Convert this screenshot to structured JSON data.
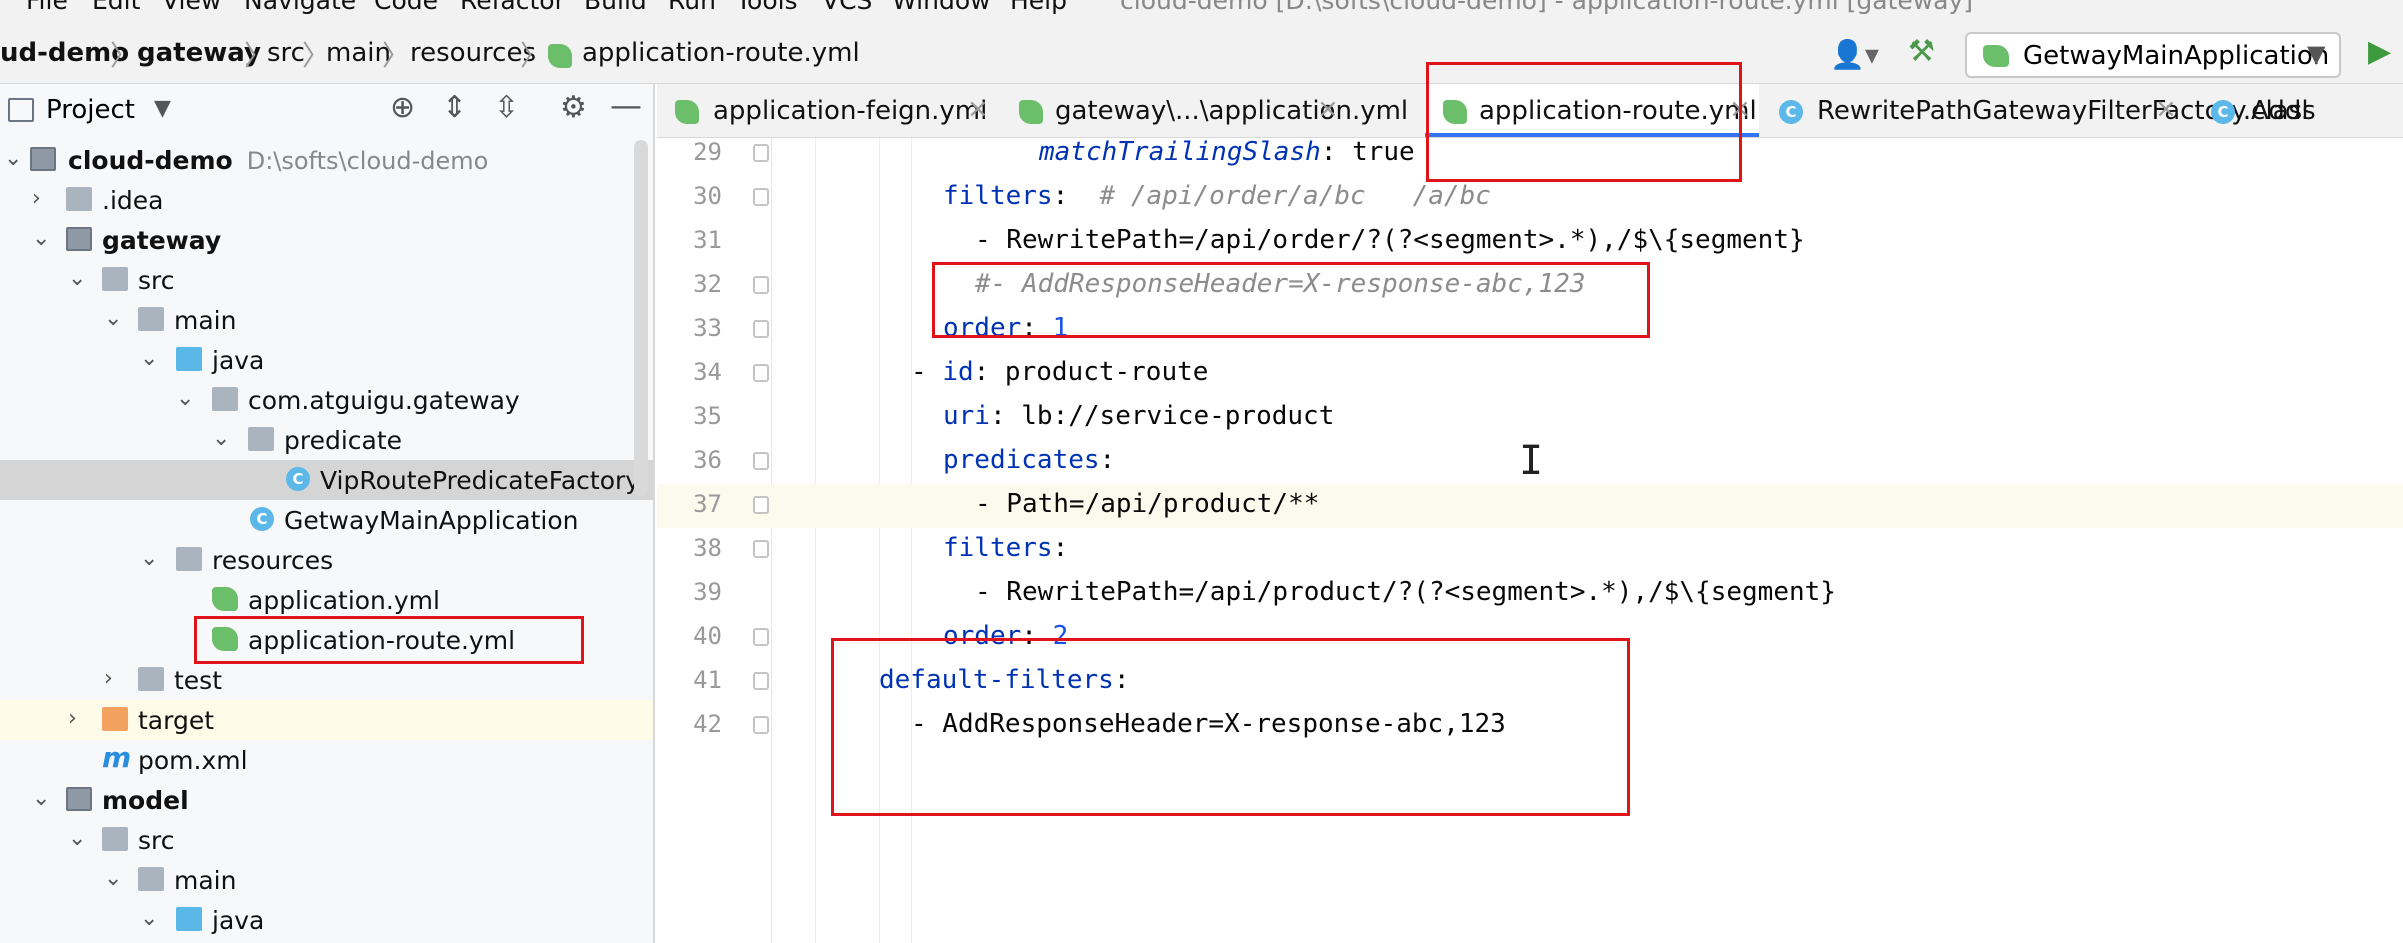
{
  "menu": {
    "items": [
      "File",
      "Edit",
      "View",
      "Navigate",
      "Code",
      "Refactor",
      "Build",
      "Run",
      "Tools",
      "VCS",
      "Window",
      "Help"
    ],
    "window_title": "cloud-demo [D:\\softs\\cloud-demo] - application-route.yml [gateway]"
  },
  "breadcrumb": {
    "items": [
      "ud-demo",
      "gateway",
      "src",
      "main",
      "resources",
      "application-route.yml"
    ]
  },
  "run_config": {
    "label": "GetwayMainApplication"
  },
  "project_panel": {
    "title": "Project",
    "tree": [
      {
        "label": "cloud-demo",
        "path": "D:\\softs\\cloud-demo"
      },
      {
        "label": ".idea"
      },
      {
        "label": "gateway"
      },
      {
        "label": "src"
      },
      {
        "label": "main"
      },
      {
        "label": "java"
      },
      {
        "label": "com.atguigu.gateway"
      },
      {
        "label": "predicate"
      },
      {
        "label": "VipRoutePredicateFactory"
      },
      {
        "label": "GetwayMainApplication"
      },
      {
        "label": "resources"
      },
      {
        "label": "application.yml"
      },
      {
        "label": "application-route.yml"
      },
      {
        "label": "test"
      },
      {
        "label": "target"
      },
      {
        "label": "pom.xml"
      },
      {
        "label": "model"
      },
      {
        "label": "src"
      },
      {
        "label": "main"
      },
      {
        "label": "java"
      }
    ]
  },
  "tabs": [
    {
      "label": "application-feign.yml"
    },
    {
      "label": "gateway\\...\\application.yml"
    },
    {
      "label": "application-route.yml"
    },
    {
      "label": "RewritePathGatewayFilterFactory.class"
    },
    {
      "label": "Addl"
    }
  ],
  "editor": {
    "line_numbers": [
      "29",
      "30",
      "31",
      "32",
      "33",
      "34",
      "35",
      "36",
      "37",
      "38",
      "39",
      "40",
      "41",
      "42"
    ],
    "lines": {
      "l29_key": "matchTrailingSlash",
      "l29_val": ": true",
      "l30_key": "filters",
      "l30_colon": ":",
      "l30_comment": "# /api/order/a/bc   /a/bc",
      "l31": "- RewritePath=/api/order/?(?<segment>.*),/$\\{segment}",
      "l32": "#- AddResponseHeader=X-response-abc,123",
      "l33_key": "order",
      "l33_colon": ": ",
      "l33_val": "1",
      "l34_dash": "- ",
      "l34_key": "id",
      "l34_val": ": product-route",
      "l35_key": "uri",
      "l35_val": ": lb://service-product",
      "l36_key": "predicates",
      "l36_colon": ":",
      "l37": "- Path=/api/product/**",
      "l38_key": "filters",
      "l38_colon": ":",
      "l39": "- RewritePath=/api/product/?(?<segment>.*),/$\\{segment}",
      "l40_key": "order",
      "l40_colon": ": ",
      "l40_val": "2",
      "l41_key": "default-filters",
      "l41_colon": ":",
      "l42": "- AddResponseHeader=X-response-abc,123"
    }
  }
}
